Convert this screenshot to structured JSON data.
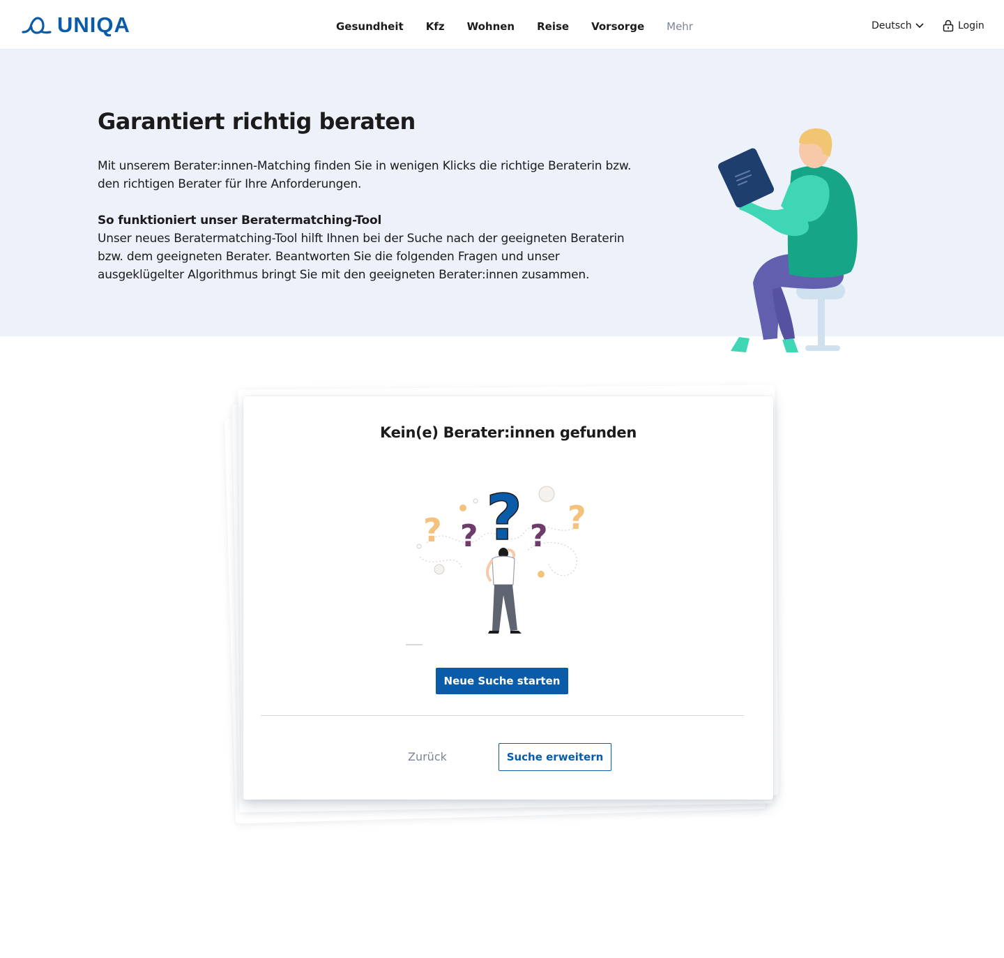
{
  "header": {
    "logo_text": "UNIQA",
    "nav": [
      "Gesundheit",
      "Kfz",
      "Wohnen",
      "Reise",
      "Vorsorge",
      "Mehr"
    ],
    "language": "Deutsch",
    "login": "Login"
  },
  "hero": {
    "title": "Garantiert richtig beraten",
    "intro": "Mit unserem Berater:innen-Matching finden Sie in wenigen Klicks die richtige Beraterin bzw. den richtigen Berater für Ihre Anforderungen.",
    "subtitle": "So funktioniert unser Beratermatching-Tool",
    "body": "Unser neues Beratermatching-Tool hilft Ihnen bei der Suche nach der geeigneten Beraterin bzw. dem geeigneten Berater. Beantworten Sie die folgenden Fragen und unser ausgeklügelter Algorithmus bringt Sie mit den geeigneten Berater:innen zusammen."
  },
  "result_card": {
    "title": "Kein(e) Berater:innen gefunden",
    "new_search_label": "Neue Suche starten",
    "back_label": "Zurück",
    "extend_label": "Suche erweitern"
  },
  "colors": {
    "brand": "#0a5ca8",
    "hero_bg": "#edf2fa",
    "muted": "#7c8594"
  }
}
